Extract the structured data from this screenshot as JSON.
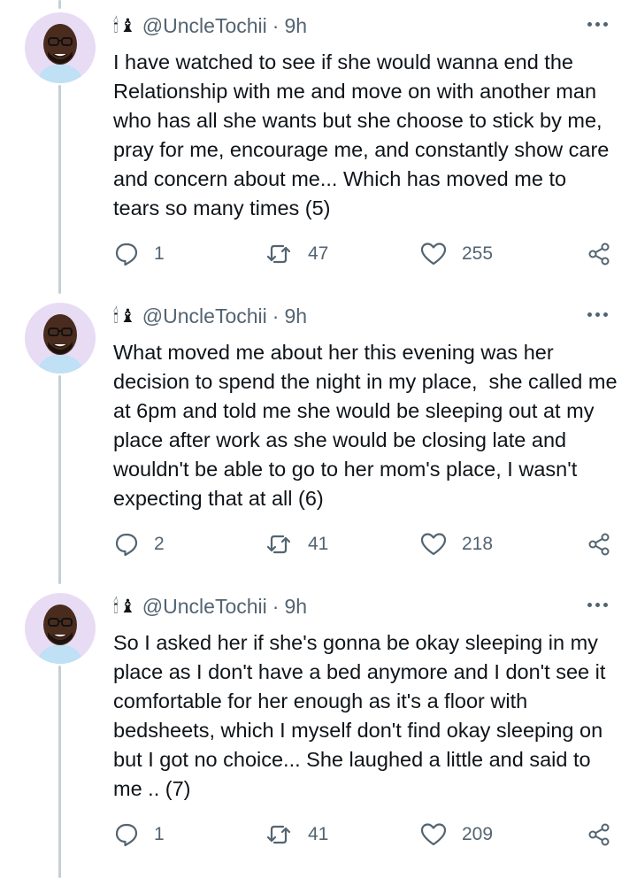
{
  "colors": {
    "text": "#0f1419",
    "muted": "#536471",
    "thread_line": "#c4cfd6",
    "avatar_bg": "#e8dcf5"
  },
  "tweets": [
    {
      "emoji": "🕯♝",
      "handle": "@UncleTochii",
      "separator": "·",
      "time": "9h",
      "text": "I have watched to see if she would wanna end the Relationship with me and move on with another man who has all she wants but she choose to stick by me,  pray for me, encourage me, and constantly show care and concern about me... Which has moved me to tears so many times (5)",
      "replies": "1",
      "retweets": "47",
      "likes": "255"
    },
    {
      "emoji": "🕯♝",
      "handle": "@UncleTochii",
      "separator": "·",
      "time": "9h",
      "text": "What moved me about her this evening was her decision to spend the night in my place,  she called me at 6pm and told me she would be sleeping out at my place after work as she would be closing late and wouldn't be able to go to her mom's place, I wasn't expecting that at all (6)",
      "replies": "2",
      "retweets": "41",
      "likes": "218"
    },
    {
      "emoji": "🕯♝",
      "handle": "@UncleTochii",
      "separator": "·",
      "time": "9h",
      "text": "So I asked her if she's gonna be okay sleeping in my place as I don't have a bed anymore and I don't see it comfortable for her enough as it's a floor with bedsheets, which I myself don't find okay sleeping on but I got no choice... She laughed a little and said to me .. (7)",
      "replies": "1",
      "retweets": "41",
      "likes": "209"
    }
  ]
}
